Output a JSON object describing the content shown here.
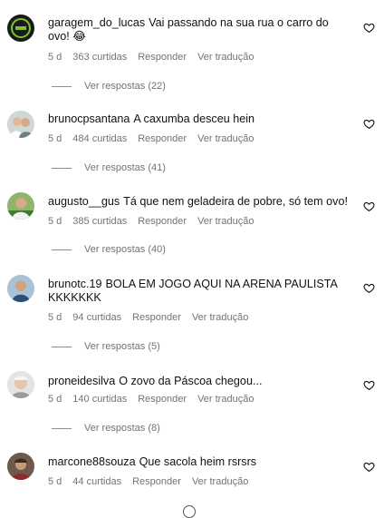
{
  "comments": [
    {
      "username": "garagem_do_lucas",
      "text": "Vai passando na sua rua o carro do ovo! 😂",
      "time": "5 d",
      "likes": "363 curtidas",
      "reply_label": "Responder",
      "translate_label": "Ver tradução",
      "replies_label": "Ver respostas (22)",
      "avatar_icon": "garage-logo-avatar"
    },
    {
      "username": "brunocpsantana",
      "text": "A caxumba desceu hein",
      "time": "5 d",
      "likes": "484 curtidas",
      "reply_label": "Responder",
      "translate_label": "Ver tradução",
      "replies_label": "Ver respostas (41)",
      "avatar_icon": "couple-photo-avatar"
    },
    {
      "username": "augusto__gus",
      "text": "Tá que nem geladeira de pobre, só tem ovo!",
      "time": "5 d",
      "likes": "385 curtidas",
      "reply_label": "Responder",
      "translate_label": "Ver tradução",
      "replies_label": "Ver respostas (40)",
      "avatar_icon": "person-field-avatar"
    },
    {
      "username": "brunotc.19",
      "text": "BOLA EM JOGO AQUI NA ARENA PAULISTA KKKKKKK",
      "time": "5 d",
      "likes": "94 curtidas",
      "reply_label": "Responder",
      "translate_label": "Ver tradução",
      "replies_label": "Ver respostas (5)",
      "avatar_icon": "person-blue-avatar"
    },
    {
      "username": "proneidesilva",
      "text": "O zovo da Páscoa chegou...",
      "time": "5 d",
      "likes": "140 curtidas",
      "reply_label": "Responder",
      "translate_label": "Ver tradução",
      "replies_label": "Ver respostas (8)",
      "avatar_icon": "person-light-avatar"
    },
    {
      "username": "marcone88souza",
      "text": "Que sacola heim rsrsrs",
      "time": "5 d",
      "likes": "44 curtidas",
      "reply_label": "Responder",
      "translate_label": "Ver tradução",
      "avatar_icon": "person-dark-avatar"
    }
  ],
  "icons": {
    "like": "heart-outline-icon",
    "loading": "loading-spinner-icon"
  },
  "colors": {
    "text": "#111111",
    "secondary": "#737373",
    "background": "#ffffff"
  }
}
